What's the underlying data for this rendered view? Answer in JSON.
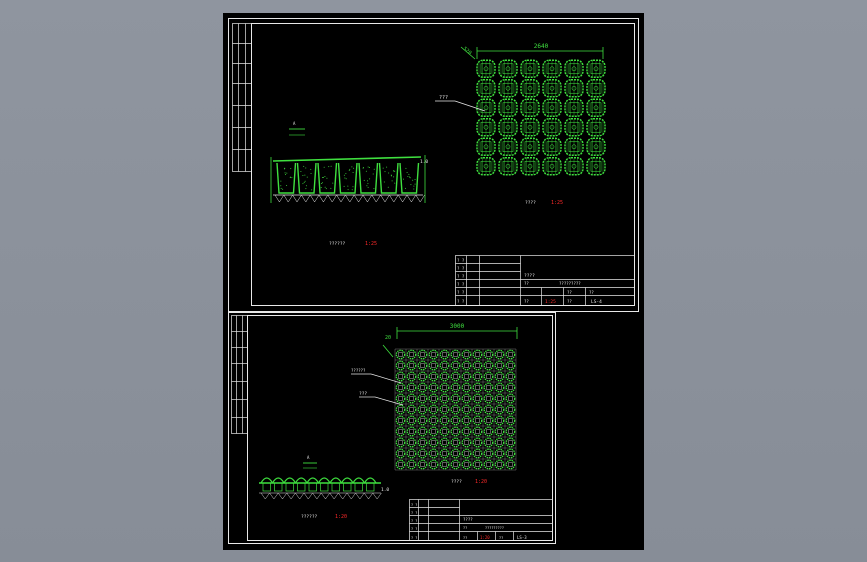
{
  "colors": {
    "background": "#8c929c",
    "paper": "#000000",
    "line_white": "#e8e8e8",
    "line_green": "#3fe03f",
    "text_red": "#ff2a2a"
  },
  "sheet1": {
    "dim_top": "2640",
    "dim_side": "520",
    "leader_label": "???",
    "section_mark": "A",
    "elevation_label": "1.0",
    "plan_caption": "????",
    "plan_scale": "1:25",
    "section_caption": "??????",
    "section_scale": "1:25",
    "title_block": {
      "name": "????",
      "drawing_title": "?????????",
      "scale_label": "??",
      "scale_value": "1:25",
      "sheet_label": "??",
      "number_label": "??",
      "number": "LS-4",
      "row_labels": [
        "? ?",
        "? ?",
        "? ?",
        "? ?",
        "? ?",
        "? ?"
      ]
    }
  },
  "sheet2": {
    "dim_top": "3000",
    "dim_side": "20",
    "leader_label_1": "??????",
    "leader_label_2": "???",
    "section_mark": "A",
    "elevation_label": "1.0",
    "plan_caption": "????",
    "plan_scale": "1:20",
    "section_caption": "??????",
    "section_scale": "1:20",
    "title_block": {
      "name": "????",
      "drawing_title": "?????????",
      "scale_label": "??",
      "scale_value": "1:20",
      "sheet_label": "??",
      "number": "LS-3",
      "row_labels": [
        "? ?",
        "? ?",
        "? ?",
        "? ?",
        "? ?"
      ]
    }
  }
}
